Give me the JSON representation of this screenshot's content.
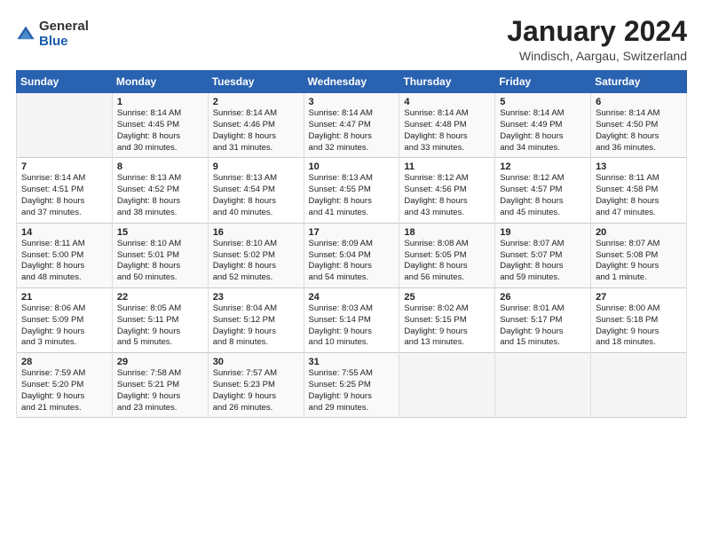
{
  "logo": {
    "general": "General",
    "blue": "Blue"
  },
  "title": "January 2024",
  "location": "Windisch, Aargau, Switzerland",
  "days_header": [
    "Sunday",
    "Monday",
    "Tuesday",
    "Wednesday",
    "Thursday",
    "Friday",
    "Saturday"
  ],
  "weeks": [
    [
      {
        "day": "",
        "info": ""
      },
      {
        "day": "1",
        "info": "Sunrise: 8:14 AM\nSunset: 4:45 PM\nDaylight: 8 hours\nand 30 minutes."
      },
      {
        "day": "2",
        "info": "Sunrise: 8:14 AM\nSunset: 4:46 PM\nDaylight: 8 hours\nand 31 minutes."
      },
      {
        "day": "3",
        "info": "Sunrise: 8:14 AM\nSunset: 4:47 PM\nDaylight: 8 hours\nand 32 minutes."
      },
      {
        "day": "4",
        "info": "Sunrise: 8:14 AM\nSunset: 4:48 PM\nDaylight: 8 hours\nand 33 minutes."
      },
      {
        "day": "5",
        "info": "Sunrise: 8:14 AM\nSunset: 4:49 PM\nDaylight: 8 hours\nand 34 minutes."
      },
      {
        "day": "6",
        "info": "Sunrise: 8:14 AM\nSunset: 4:50 PM\nDaylight: 8 hours\nand 36 minutes."
      }
    ],
    [
      {
        "day": "7",
        "info": "Sunrise: 8:14 AM\nSunset: 4:51 PM\nDaylight: 8 hours\nand 37 minutes."
      },
      {
        "day": "8",
        "info": "Sunrise: 8:13 AM\nSunset: 4:52 PM\nDaylight: 8 hours\nand 38 minutes."
      },
      {
        "day": "9",
        "info": "Sunrise: 8:13 AM\nSunset: 4:54 PM\nDaylight: 8 hours\nand 40 minutes."
      },
      {
        "day": "10",
        "info": "Sunrise: 8:13 AM\nSunset: 4:55 PM\nDaylight: 8 hours\nand 41 minutes."
      },
      {
        "day": "11",
        "info": "Sunrise: 8:12 AM\nSunset: 4:56 PM\nDaylight: 8 hours\nand 43 minutes."
      },
      {
        "day": "12",
        "info": "Sunrise: 8:12 AM\nSunset: 4:57 PM\nDaylight: 8 hours\nand 45 minutes."
      },
      {
        "day": "13",
        "info": "Sunrise: 8:11 AM\nSunset: 4:58 PM\nDaylight: 8 hours\nand 47 minutes."
      }
    ],
    [
      {
        "day": "14",
        "info": "Sunrise: 8:11 AM\nSunset: 5:00 PM\nDaylight: 8 hours\nand 48 minutes."
      },
      {
        "day": "15",
        "info": "Sunrise: 8:10 AM\nSunset: 5:01 PM\nDaylight: 8 hours\nand 50 minutes."
      },
      {
        "day": "16",
        "info": "Sunrise: 8:10 AM\nSunset: 5:02 PM\nDaylight: 8 hours\nand 52 minutes."
      },
      {
        "day": "17",
        "info": "Sunrise: 8:09 AM\nSunset: 5:04 PM\nDaylight: 8 hours\nand 54 minutes."
      },
      {
        "day": "18",
        "info": "Sunrise: 8:08 AM\nSunset: 5:05 PM\nDaylight: 8 hours\nand 56 minutes."
      },
      {
        "day": "19",
        "info": "Sunrise: 8:07 AM\nSunset: 5:07 PM\nDaylight: 8 hours\nand 59 minutes."
      },
      {
        "day": "20",
        "info": "Sunrise: 8:07 AM\nSunset: 5:08 PM\nDaylight: 9 hours\nand 1 minute."
      }
    ],
    [
      {
        "day": "21",
        "info": "Sunrise: 8:06 AM\nSunset: 5:09 PM\nDaylight: 9 hours\nand 3 minutes."
      },
      {
        "day": "22",
        "info": "Sunrise: 8:05 AM\nSunset: 5:11 PM\nDaylight: 9 hours\nand 5 minutes."
      },
      {
        "day": "23",
        "info": "Sunrise: 8:04 AM\nSunset: 5:12 PM\nDaylight: 9 hours\nand 8 minutes."
      },
      {
        "day": "24",
        "info": "Sunrise: 8:03 AM\nSunset: 5:14 PM\nDaylight: 9 hours\nand 10 minutes."
      },
      {
        "day": "25",
        "info": "Sunrise: 8:02 AM\nSunset: 5:15 PM\nDaylight: 9 hours\nand 13 minutes."
      },
      {
        "day": "26",
        "info": "Sunrise: 8:01 AM\nSunset: 5:17 PM\nDaylight: 9 hours\nand 15 minutes."
      },
      {
        "day": "27",
        "info": "Sunrise: 8:00 AM\nSunset: 5:18 PM\nDaylight: 9 hours\nand 18 minutes."
      }
    ],
    [
      {
        "day": "28",
        "info": "Sunrise: 7:59 AM\nSunset: 5:20 PM\nDaylight: 9 hours\nand 21 minutes."
      },
      {
        "day": "29",
        "info": "Sunrise: 7:58 AM\nSunset: 5:21 PM\nDaylight: 9 hours\nand 23 minutes."
      },
      {
        "day": "30",
        "info": "Sunrise: 7:57 AM\nSunset: 5:23 PM\nDaylight: 9 hours\nand 26 minutes."
      },
      {
        "day": "31",
        "info": "Sunrise: 7:55 AM\nSunset: 5:25 PM\nDaylight: 9 hours\nand 29 minutes."
      },
      {
        "day": "",
        "info": ""
      },
      {
        "day": "",
        "info": ""
      },
      {
        "day": "",
        "info": ""
      }
    ]
  ]
}
